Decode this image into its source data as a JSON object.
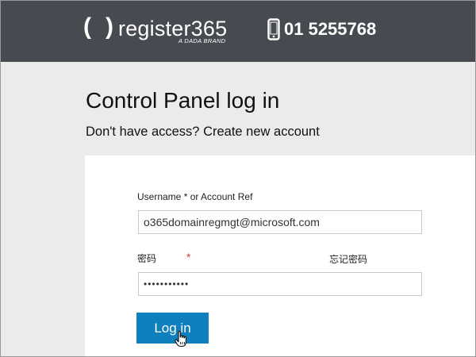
{
  "brand": {
    "paren_left": "(",
    "paren_right": ")",
    "name": "register365",
    "tagline": "A DADA BRAND",
    "phone": "01 5255768",
    "phone_icon": "mobile-phone-icon",
    "header_color": "#474a51"
  },
  "page": {
    "title": "Control Panel log in",
    "subtitle": "Don't have access? Create new account"
  },
  "form": {
    "username_label": "Username * or Account Ref",
    "username_value": "o365domainregmgt@microsoft.com",
    "password_label": "密码",
    "password_required": "*",
    "password_value": "•••••••••••",
    "forgot_password": "忘记密码",
    "login_label": "Log in",
    "login_color": "#0f7fbd"
  },
  "cursor": "hand-pointer-icon"
}
